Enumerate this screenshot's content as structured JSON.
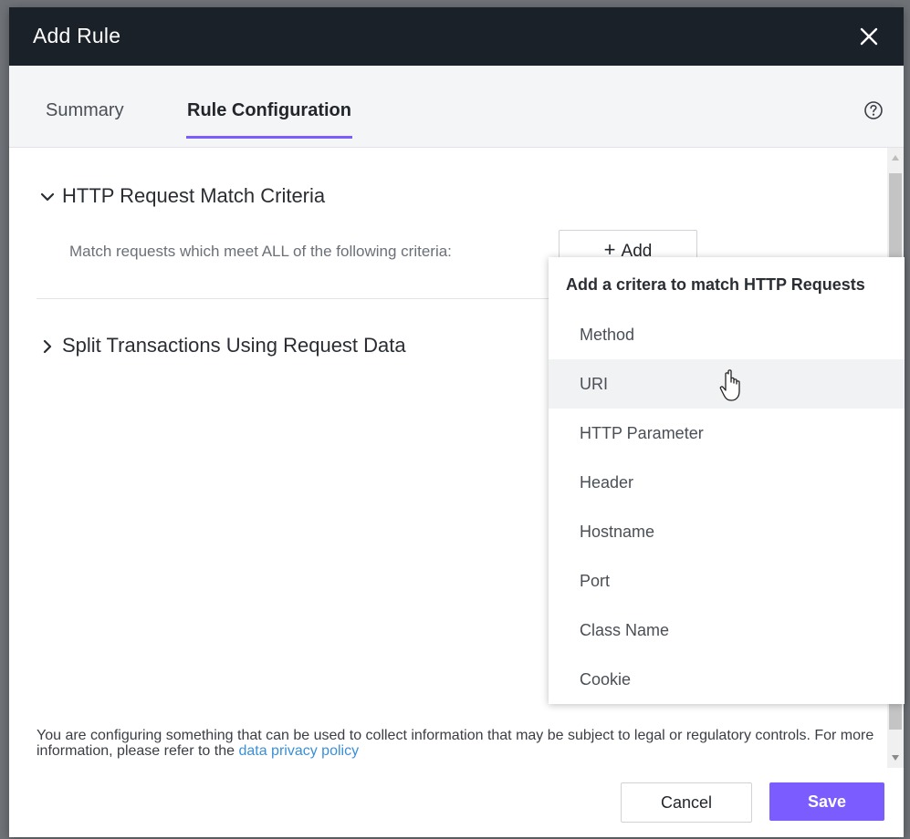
{
  "dialog": {
    "title": "Add Rule"
  },
  "tabs": [
    {
      "label": "Summary",
      "selected": false
    },
    {
      "label": "Rule Configuration",
      "selected": true
    }
  ],
  "sections": {
    "match": {
      "title": "HTTP Request Match Criteria",
      "expanded": true,
      "description": "Match requests which meet ALL of the following criteria:",
      "add_button_label": "Add"
    },
    "split": {
      "title": "Split Transactions Using Request Data",
      "expanded": false
    }
  },
  "dropdown": {
    "title": "Add a critera to match HTTP Requests",
    "items": [
      "Method",
      "URI",
      "HTTP Parameter",
      "Header",
      "Hostname",
      "Port",
      "Class Name",
      "Cookie"
    ],
    "hovered": "URI"
  },
  "footer": {
    "notice": "You are configuring something that can be used to collect information that may be subject to legal or regulatory controls. For more information, please refer to the",
    "link": "data privacy policy",
    "cancel_label": "Cancel",
    "save_label": "Save"
  },
  "colors": {
    "titlebar": "#1b2128",
    "accent": "#7b5cff",
    "link": "#3a8fd8"
  },
  "icons": {
    "close": "close-icon",
    "help": "help-icon",
    "expanded": "chevron-down-icon",
    "collapsed": "chevron-right-icon",
    "plus": "plus-icon",
    "cursor": "hand-pointer-icon"
  }
}
